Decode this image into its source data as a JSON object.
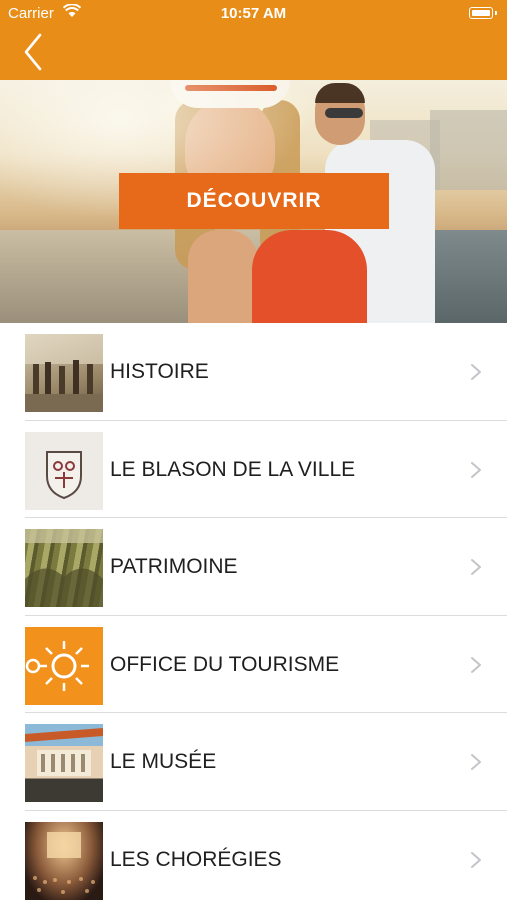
{
  "status_bar": {
    "carrier": "Carrier",
    "time": "10:57 AM",
    "wifi_icon": "wifi-icon",
    "battery_icon": "battery-icon"
  },
  "header": {
    "back_icon": "chevron-left-icon",
    "background_color": "#e88e18"
  },
  "hero": {
    "button_label": "DÉCOUVRIR",
    "button_color": "#e66a1a"
  },
  "menu": {
    "items": [
      {
        "label": "HISTOIRE",
        "thumbnail": "histoire-thumbnail"
      },
      {
        "label": "LE BLASON DE LA VILLE",
        "thumbnail": "blason-thumbnail"
      },
      {
        "label": "PATRIMOINE",
        "thumbnail": "patrimoine-thumbnail"
      },
      {
        "label": "OFFICE DU TOURISME",
        "thumbnail": "office-thumbnail"
      },
      {
        "label": "LE MUSÉE",
        "thumbnail": "musee-thumbnail"
      },
      {
        "label": "LES CHORÉGIES",
        "thumbnail": "choregies-thumbnail"
      }
    ],
    "chevron_icon": "chevron-right-icon"
  }
}
